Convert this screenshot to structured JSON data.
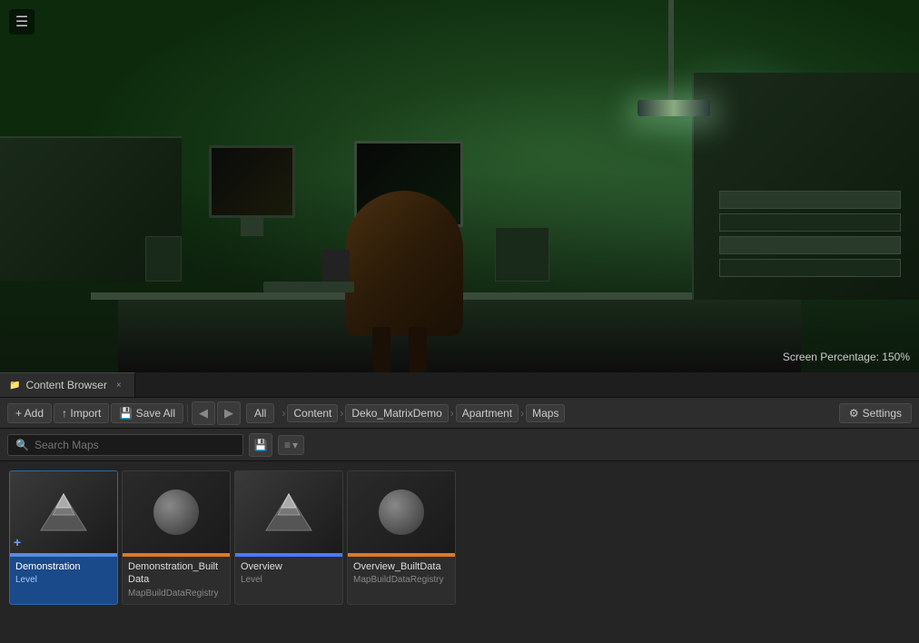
{
  "viewport": {
    "screen_percentage_label": "Screen Percentage: 150%"
  },
  "menu_button": "☰",
  "tab_bar": {
    "tabs": [
      {
        "id": "content-browser",
        "icon": "📁",
        "label": "Content Browser",
        "close": "×"
      }
    ]
  },
  "toolbar": {
    "add_label": "+ Add",
    "import_label": "↑ Import",
    "save_all_label": "💾 Save All",
    "nav_back": "◀",
    "nav_forward": "▶",
    "all_label": "All",
    "settings_icon": "⚙",
    "settings_label": "Settings"
  },
  "breadcrumb": {
    "items": [
      {
        "label": "Content"
      },
      {
        "label": "Deko_MatrixDemo"
      },
      {
        "label": "Apartment"
      },
      {
        "label": "Maps"
      }
    ],
    "separators": [
      "›",
      "›",
      "›",
      "›"
    ]
  },
  "search": {
    "placeholder": "Search Maps",
    "icon": "🔍"
  },
  "view_options": {
    "save_icon": "💾",
    "sort_icon": "≡",
    "dropdown_icon": "▾"
  },
  "assets": [
    {
      "id": "demonstration",
      "name": "Demonstration",
      "type": "Level",
      "thumbnail_type": "level",
      "selected": true,
      "has_add_icon": true
    },
    {
      "id": "demonstration-builtdata",
      "name": "Demonstration_BuiltData",
      "type": "MapBuildDataRegistry",
      "thumbnail_type": "registry",
      "selected": false,
      "has_add_icon": false
    },
    {
      "id": "overview",
      "name": "Overview",
      "type": "Level",
      "thumbnail_type": "level",
      "selected": false,
      "has_add_icon": false
    },
    {
      "id": "overview-builtdata",
      "name": "Overview_BuiltData",
      "type": "MapBuildDataRegistry",
      "thumbnail_type": "registry",
      "selected": false,
      "has_add_icon": false
    }
  ],
  "colors": {
    "selected_bg": "#1a4a8a",
    "level_bar": "#4a7aff",
    "registry_bar": "#e07a20"
  }
}
